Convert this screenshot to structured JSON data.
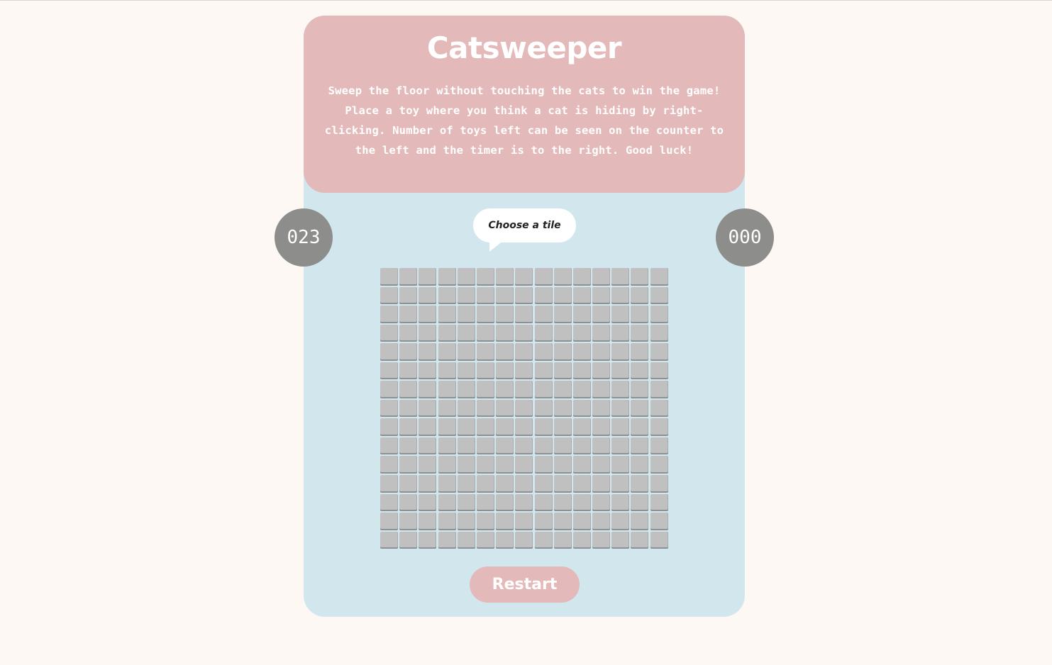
{
  "header": {
    "title": "Catsweeper",
    "description": "Sweep the floor without touching the cats to win the game! Place a toy where you think a cat is hiding by right-clicking. Number of toys left can be seen on the counter to the left and the timer is to the right. Good luck!"
  },
  "counters": {
    "toys_left": "023",
    "timer": "000"
  },
  "status_bubble": {
    "text": "Choose a tile"
  },
  "board": {
    "rows": 15,
    "cols": 15,
    "tile_state": "unrevealed"
  },
  "controls": {
    "restart_label": "Restart"
  },
  "colors": {
    "page_background": "#fef8f4",
    "card_background": "#d1e7ed",
    "header_background": "#e4b9b9",
    "counter_background": "#8d8d8b",
    "tile": "#c1c0c0",
    "button": "#e4b9b9",
    "text_on_accent": "#ffffff"
  }
}
